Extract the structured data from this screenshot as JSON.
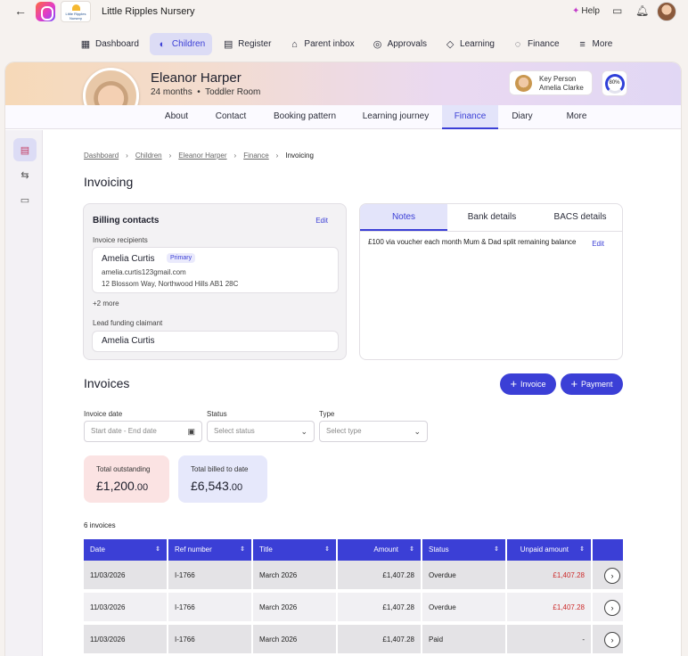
{
  "topbar": {
    "nursery_logo_text": "Little Ripples Nursery",
    "nursery_name": "Little Ripples Nursery",
    "help_label": "Help"
  },
  "mainnav": [
    {
      "label": "Dashboard",
      "icon": "grid-icon"
    },
    {
      "label": "Children",
      "icon": "children-icon",
      "active": true
    },
    {
      "label": "Register",
      "icon": "register-icon"
    },
    {
      "label": "Parent inbox",
      "icon": "inbox-icon"
    },
    {
      "label": "Approvals",
      "icon": "check-circle-icon"
    },
    {
      "label": "Learning",
      "icon": "graduation-icon"
    },
    {
      "label": "Finance",
      "icon": "piggy-bank-icon"
    },
    {
      "label": "More",
      "icon": "menu-icon"
    }
  ],
  "profile": {
    "name": "Eleanor Harper",
    "age": "24 months",
    "room": "Toddler Room",
    "key_person_title": "Key Person",
    "key_person_name": "Amelia Clarke",
    "completion": "80%"
  },
  "subtabs": [
    {
      "label": "About"
    },
    {
      "label": "Contact"
    },
    {
      "label": "Booking pattern"
    },
    {
      "label": "Learning journey"
    },
    {
      "label": "Finance",
      "active": true
    },
    {
      "label": "Diary"
    },
    {
      "label": "More"
    }
  ],
  "breadcrumb": {
    "items": [
      "Dashboard",
      "Children",
      "Eleanor Harper",
      "Finance"
    ],
    "current": "Invoicing"
  },
  "page_title": "Invoicing",
  "billing": {
    "title": "Billing contacts",
    "edit_label": "Edit",
    "recipients_label": "Invoice recipients",
    "recipient": {
      "name": "Amelia Curtis",
      "badge": "Primary",
      "email": "amelia.curtis123gmail.com",
      "address": "12 Blossom Way, Northwood Hills AB1 28C"
    },
    "more_label": "+2 more",
    "lead_label": "Lead funding claimant",
    "lead_name": "Amelia Curtis"
  },
  "notes": {
    "tabs": [
      "Notes",
      "Bank details",
      "BACS details"
    ],
    "text": "£100 via voucher each month Mum & Dad split remaining balance",
    "edit_label": "Edit"
  },
  "invoices": {
    "title": "Invoices",
    "invoice_button": "Invoice",
    "payment_button": "Payment",
    "filters": {
      "date_label": "Invoice date",
      "date_placeholder": "Start date - End date",
      "status_label": "Status",
      "status_placeholder": "Select status",
      "type_label": "Type",
      "type_placeholder": "Select type"
    },
    "kpis": {
      "outstanding_label": "Total outstanding",
      "outstanding_currency": "£",
      "outstanding_pounds": "1,200",
      "outstanding_pence": ".00",
      "billed_label": "Total billed to date",
      "billed_currency": "£",
      "billed_pounds": "6,543",
      "billed_pence": ".00"
    },
    "count_label": "6 invoices",
    "columns": [
      "Date",
      "Ref number",
      "Title",
      "Amount",
      "Status",
      "Unpaid amount"
    ],
    "rows": [
      {
        "date": "11/03/2026",
        "ref": "I-1766",
        "title": "March 2026",
        "amount": "£1,407.28",
        "status": "Overdue",
        "unpaid": "£1,407.28"
      },
      {
        "date": "11/03/2026",
        "ref": "I-1766",
        "title": "March 2026",
        "amount": "£1,407.28",
        "status": "Overdue",
        "unpaid": "£1,407.28"
      },
      {
        "date": "11/03/2026",
        "ref": "I-1766",
        "title": "March 2026",
        "amount": "£1,407.28",
        "status": "Paid",
        "unpaid": "-"
      }
    ]
  },
  "colors": {
    "accent": "#3b3fd6",
    "overdue": "#cc2a2a",
    "outstanding_bg": "#fbe3e3",
    "billed_bg": "#e6e8fb"
  }
}
